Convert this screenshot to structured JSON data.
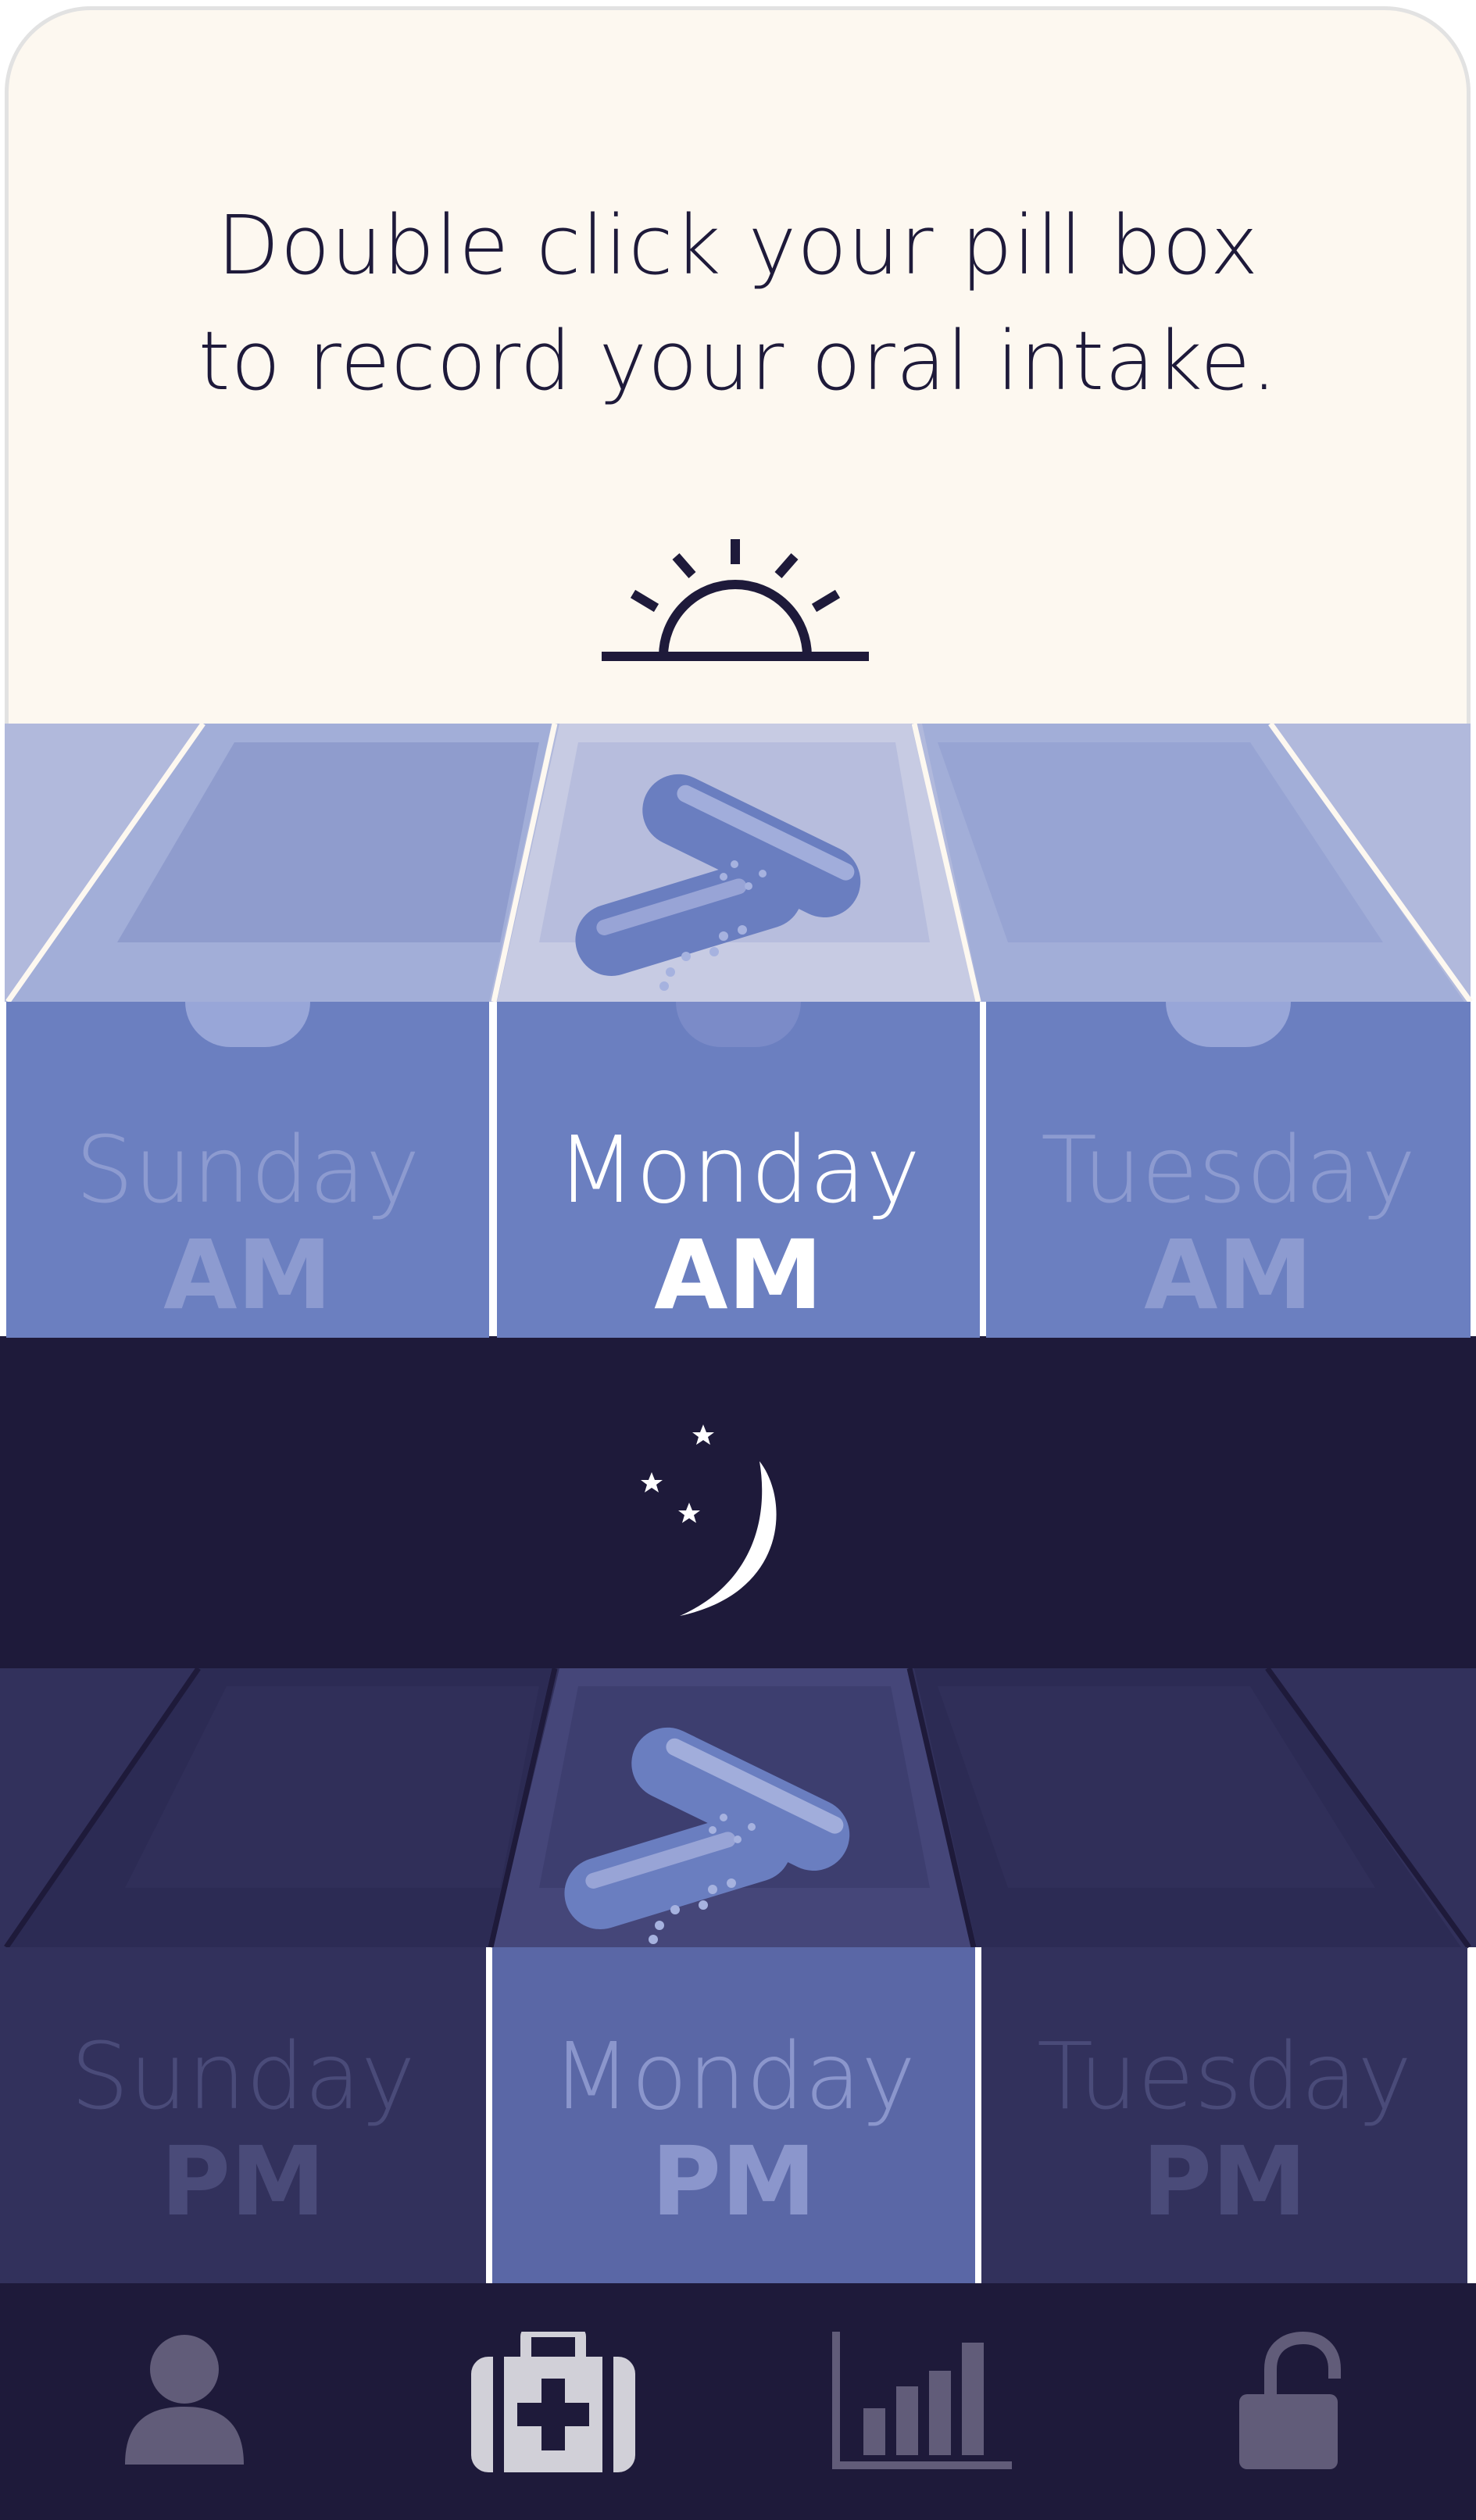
{
  "instruction": {
    "line1": "Double click your pill box",
    "line2": "to record your oral intake."
  },
  "icons": {
    "morning": "sunrise-icon",
    "evening": "moon-stars-icon"
  },
  "am_row": [
    {
      "day": "Sunday",
      "period": "AM",
      "active": false,
      "has_pills": false
    },
    {
      "day": "Monday",
      "period": "AM",
      "active": true,
      "has_pills": true
    },
    {
      "day": "Tuesday",
      "period": "AM",
      "active": false,
      "has_pills": false
    }
  ],
  "pm_row": [
    {
      "day": "Sunday",
      "period": "PM",
      "active": false,
      "has_pills": false
    },
    {
      "day": "Monday",
      "period": "PM",
      "active": true,
      "has_pills": true
    },
    {
      "day": "Tuesday",
      "period": "PM",
      "active": false,
      "has_pills": false
    }
  ],
  "tabbar": {
    "items": [
      {
        "icon": "user-icon",
        "active": false
      },
      {
        "icon": "medical-kit-icon",
        "active": true
      },
      {
        "icon": "bar-chart-icon",
        "active": false
      },
      {
        "icon": "unlock-icon",
        "active": false
      }
    ]
  },
  "colors": {
    "cream": "#fdf8f0",
    "navy": "#1e1a3a",
    "am_blue": "#6b7fc0",
    "pill_blue": "#6a7ec0",
    "tab_icon": "#615c79",
    "tab_icon_active": "#d1d0d8"
  }
}
